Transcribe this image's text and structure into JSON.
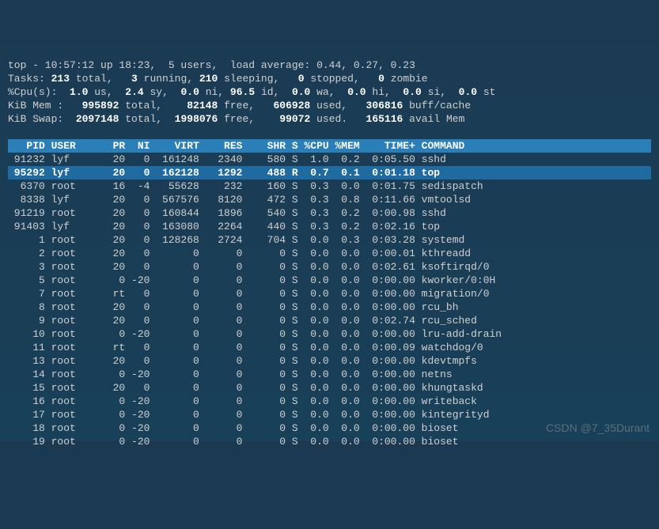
{
  "summary": {
    "line1_pre": "top - ",
    "time": "10:57:12",
    "up_pre": " up ",
    "uptime": "18:23",
    "users": "5",
    "users_suf": " users,  load average: ",
    "load": "0.44, 0.27, 0.23",
    "tasks_label": "Tasks:",
    "tasks_total": "213",
    "tasks_running": "3",
    "tasks_sleeping": "210",
    "tasks_stopped": "0",
    "tasks_zombie": "0",
    "cpu_label": "%Cpu(s):",
    "cpu_us": "1.0",
    "cpu_sy": "2.4",
    "cpu_ni": "0.0",
    "cpu_id": "96.5",
    "cpu_wa": "0.0",
    "cpu_hi": "0.0",
    "cpu_si": "0.0",
    "cpu_st": "0.0",
    "mem_label": "KiB Mem :",
    "mem_total": "995892",
    "mem_free": "82148",
    "mem_used": "606928",
    "mem_buff": "306816",
    "swap_label": "KiB Swap:",
    "swap_total": "2097148",
    "swap_free": "1998076",
    "swap_used": "99072",
    "swap_avail": "165116"
  },
  "cols": {
    "pid": "PID",
    "user": "USER",
    "pr": "PR",
    "ni": "NI",
    "virt": "VIRT",
    "res": "RES",
    "shr": "SHR",
    "s": "S",
    "cpu": "%CPU",
    "mem": "%MEM",
    "time": "TIME+",
    "cmd": "COMMAND"
  },
  "rows": [
    {
      "pid": "91232",
      "user": "lyf",
      "pr": "20",
      "ni": "0",
      "virt": "161248",
      "res": "2340",
      "shr": "580",
      "s": "S",
      "cpu": "1.0",
      "mem": "0.2",
      "time": "0:05.50",
      "cmd": "sshd",
      "sel": false
    },
    {
      "pid": "95292",
      "user": "lyf",
      "pr": "20",
      "ni": "0",
      "virt": "162128",
      "res": "1292",
      "shr": "488",
      "s": "R",
      "cpu": "0.7",
      "mem": "0.1",
      "time": "0:01.18",
      "cmd": "top",
      "sel": true
    },
    {
      "pid": "6370",
      "user": "root",
      "pr": "16",
      "ni": "-4",
      "virt": "55628",
      "res": "232",
      "shr": "160",
      "s": "S",
      "cpu": "0.3",
      "mem": "0.0",
      "time": "0:01.75",
      "cmd": "sedispatch",
      "sel": false
    },
    {
      "pid": "8338",
      "user": "lyf",
      "pr": "20",
      "ni": "0",
      "virt": "567576",
      "res": "8120",
      "shr": "472",
      "s": "S",
      "cpu": "0.3",
      "mem": "0.8",
      "time": "0:11.66",
      "cmd": "vmtoolsd",
      "sel": false
    },
    {
      "pid": "91219",
      "user": "root",
      "pr": "20",
      "ni": "0",
      "virt": "160844",
      "res": "1896",
      "shr": "540",
      "s": "S",
      "cpu": "0.3",
      "mem": "0.2",
      "time": "0:00.98",
      "cmd": "sshd",
      "sel": false
    },
    {
      "pid": "91403",
      "user": "lyf",
      "pr": "20",
      "ni": "0",
      "virt": "163080",
      "res": "2264",
      "shr": "440",
      "s": "S",
      "cpu": "0.3",
      "mem": "0.2",
      "time": "0:02.16",
      "cmd": "top",
      "sel": false
    },
    {
      "pid": "1",
      "user": "root",
      "pr": "20",
      "ni": "0",
      "virt": "128268",
      "res": "2724",
      "shr": "704",
      "s": "S",
      "cpu": "0.0",
      "mem": "0.3",
      "time": "0:03.28",
      "cmd": "systemd",
      "sel": false
    },
    {
      "pid": "2",
      "user": "root",
      "pr": "20",
      "ni": "0",
      "virt": "0",
      "res": "0",
      "shr": "0",
      "s": "S",
      "cpu": "0.0",
      "mem": "0.0",
      "time": "0:00.01",
      "cmd": "kthreadd",
      "sel": false
    },
    {
      "pid": "3",
      "user": "root",
      "pr": "20",
      "ni": "0",
      "virt": "0",
      "res": "0",
      "shr": "0",
      "s": "S",
      "cpu": "0.0",
      "mem": "0.0",
      "time": "0:02.61",
      "cmd": "ksoftirqd/0",
      "sel": false
    },
    {
      "pid": "5",
      "user": "root",
      "pr": "0",
      "ni": "-20",
      "virt": "0",
      "res": "0",
      "shr": "0",
      "s": "S",
      "cpu": "0.0",
      "mem": "0.0",
      "time": "0:00.00",
      "cmd": "kworker/0:0H",
      "sel": false
    },
    {
      "pid": "7",
      "user": "root",
      "pr": "rt",
      "ni": "0",
      "virt": "0",
      "res": "0",
      "shr": "0",
      "s": "S",
      "cpu": "0.0",
      "mem": "0.0",
      "time": "0:00.00",
      "cmd": "migration/0",
      "sel": false
    },
    {
      "pid": "8",
      "user": "root",
      "pr": "20",
      "ni": "0",
      "virt": "0",
      "res": "0",
      "shr": "0",
      "s": "S",
      "cpu": "0.0",
      "mem": "0.0",
      "time": "0:00.00",
      "cmd": "rcu_bh",
      "sel": false
    },
    {
      "pid": "9",
      "user": "root",
      "pr": "20",
      "ni": "0",
      "virt": "0",
      "res": "0",
      "shr": "0",
      "s": "S",
      "cpu": "0.0",
      "mem": "0.0",
      "time": "0:02.74",
      "cmd": "rcu_sched",
      "sel": false
    },
    {
      "pid": "10",
      "user": "root",
      "pr": "0",
      "ni": "-20",
      "virt": "0",
      "res": "0",
      "shr": "0",
      "s": "S",
      "cpu": "0.0",
      "mem": "0.0",
      "time": "0:00.00",
      "cmd": "lru-add-drain",
      "sel": false
    },
    {
      "pid": "11",
      "user": "root",
      "pr": "rt",
      "ni": "0",
      "virt": "0",
      "res": "0",
      "shr": "0",
      "s": "S",
      "cpu": "0.0",
      "mem": "0.0",
      "time": "0:00.09",
      "cmd": "watchdog/0",
      "sel": false
    },
    {
      "pid": "13",
      "user": "root",
      "pr": "20",
      "ni": "0",
      "virt": "0",
      "res": "0",
      "shr": "0",
      "s": "S",
      "cpu": "0.0",
      "mem": "0.0",
      "time": "0:00.00",
      "cmd": "kdevtmpfs",
      "sel": false
    },
    {
      "pid": "14",
      "user": "root",
      "pr": "0",
      "ni": "-20",
      "virt": "0",
      "res": "0",
      "shr": "0",
      "s": "S",
      "cpu": "0.0",
      "mem": "0.0",
      "time": "0:00.00",
      "cmd": "netns",
      "sel": false
    },
    {
      "pid": "15",
      "user": "root",
      "pr": "20",
      "ni": "0",
      "virt": "0",
      "res": "0",
      "shr": "0",
      "s": "S",
      "cpu": "0.0",
      "mem": "0.0",
      "time": "0:00.00",
      "cmd": "khungtaskd",
      "sel": false
    },
    {
      "pid": "16",
      "user": "root",
      "pr": "0",
      "ni": "-20",
      "virt": "0",
      "res": "0",
      "shr": "0",
      "s": "S",
      "cpu": "0.0",
      "mem": "0.0",
      "time": "0:00.00",
      "cmd": "writeback",
      "sel": false
    },
    {
      "pid": "17",
      "user": "root",
      "pr": "0",
      "ni": "-20",
      "virt": "0",
      "res": "0",
      "shr": "0",
      "s": "S",
      "cpu": "0.0",
      "mem": "0.0",
      "time": "0:00.00",
      "cmd": "kintegrityd",
      "sel": false
    },
    {
      "pid": "18",
      "user": "root",
      "pr": "0",
      "ni": "-20",
      "virt": "0",
      "res": "0",
      "shr": "0",
      "s": "S",
      "cpu": "0.0",
      "mem": "0.0",
      "time": "0:00.00",
      "cmd": "bioset",
      "sel": false
    },
    {
      "pid": "19",
      "user": "root",
      "pr": "0",
      "ni": "-20",
      "virt": "0",
      "res": "0",
      "shr": "0",
      "s": "S",
      "cpu": "0.0",
      "mem": "0.0",
      "time": "0:00.00",
      "cmd": "bioset",
      "sel": false
    }
  ],
  "watermark": "CSDN @7_35Durant"
}
